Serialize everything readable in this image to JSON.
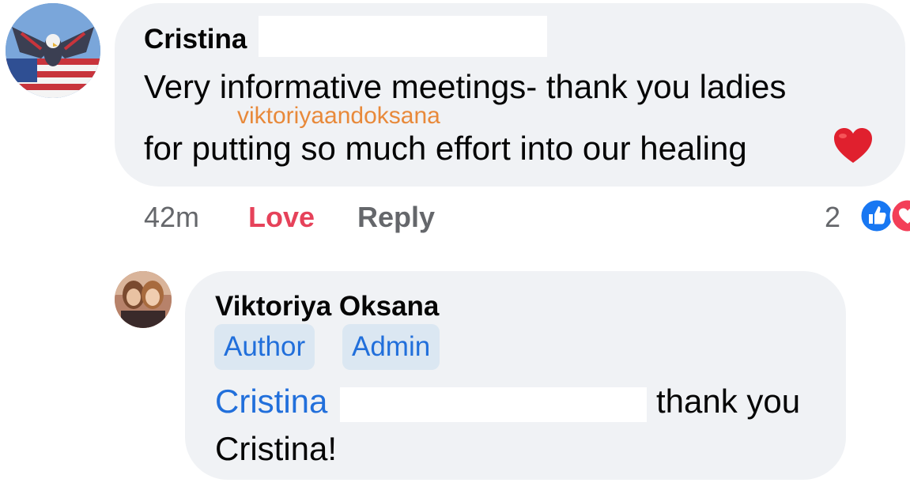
{
  "comment": {
    "author": "Cristina",
    "text_line1": "Very informative meetings- thank you ladies",
    "text_line2": "for putting so much effort into our healing",
    "emoji": "heart-emoji",
    "watermark": "viktoriyaandoksana",
    "time": "42m",
    "action_love": "Love",
    "action_reply": "Reply",
    "reaction_count": "2",
    "reactions": [
      "like-reaction-icon",
      "love-reaction-icon"
    ]
  },
  "reply": {
    "author": "Viktoriya Oksana",
    "badges": [
      "Author",
      "Admin"
    ],
    "mention": "Cristina",
    "text_after_mention": "thank you",
    "text_line2": "Cristina!"
  },
  "colors": {
    "bubble": "#f0f2f5",
    "love": "#e6425a",
    "link": "#216fdb",
    "badge_bg": "#dbe7f2",
    "watermark": "#e8893a",
    "meta": "#65676b"
  }
}
